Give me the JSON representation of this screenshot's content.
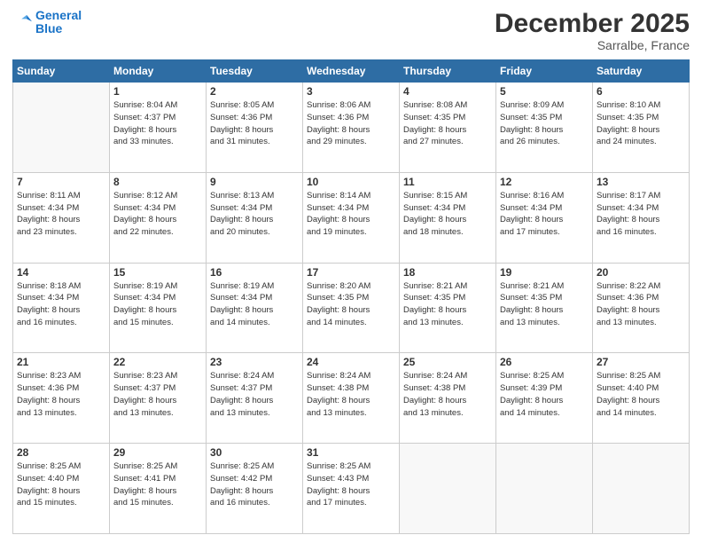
{
  "logo": {
    "line1": "General",
    "line2": "Blue"
  },
  "title": "December 2025",
  "location": "Sarralbe, France",
  "weekdays": [
    "Sunday",
    "Monday",
    "Tuesday",
    "Wednesday",
    "Thursday",
    "Friday",
    "Saturday"
  ],
  "weeks": [
    [
      {
        "day": "",
        "info": ""
      },
      {
        "day": "1",
        "info": "Sunrise: 8:04 AM\nSunset: 4:37 PM\nDaylight: 8 hours\nand 33 minutes."
      },
      {
        "day": "2",
        "info": "Sunrise: 8:05 AM\nSunset: 4:36 PM\nDaylight: 8 hours\nand 31 minutes."
      },
      {
        "day": "3",
        "info": "Sunrise: 8:06 AM\nSunset: 4:36 PM\nDaylight: 8 hours\nand 29 minutes."
      },
      {
        "day": "4",
        "info": "Sunrise: 8:08 AM\nSunset: 4:35 PM\nDaylight: 8 hours\nand 27 minutes."
      },
      {
        "day": "5",
        "info": "Sunrise: 8:09 AM\nSunset: 4:35 PM\nDaylight: 8 hours\nand 26 minutes."
      },
      {
        "day": "6",
        "info": "Sunrise: 8:10 AM\nSunset: 4:35 PM\nDaylight: 8 hours\nand 24 minutes."
      }
    ],
    [
      {
        "day": "7",
        "info": "Sunrise: 8:11 AM\nSunset: 4:34 PM\nDaylight: 8 hours\nand 23 minutes."
      },
      {
        "day": "8",
        "info": "Sunrise: 8:12 AM\nSunset: 4:34 PM\nDaylight: 8 hours\nand 22 minutes."
      },
      {
        "day": "9",
        "info": "Sunrise: 8:13 AM\nSunset: 4:34 PM\nDaylight: 8 hours\nand 20 minutes."
      },
      {
        "day": "10",
        "info": "Sunrise: 8:14 AM\nSunset: 4:34 PM\nDaylight: 8 hours\nand 19 minutes."
      },
      {
        "day": "11",
        "info": "Sunrise: 8:15 AM\nSunset: 4:34 PM\nDaylight: 8 hours\nand 18 minutes."
      },
      {
        "day": "12",
        "info": "Sunrise: 8:16 AM\nSunset: 4:34 PM\nDaylight: 8 hours\nand 17 minutes."
      },
      {
        "day": "13",
        "info": "Sunrise: 8:17 AM\nSunset: 4:34 PM\nDaylight: 8 hours\nand 16 minutes."
      }
    ],
    [
      {
        "day": "14",
        "info": "Sunrise: 8:18 AM\nSunset: 4:34 PM\nDaylight: 8 hours\nand 16 minutes."
      },
      {
        "day": "15",
        "info": "Sunrise: 8:19 AM\nSunset: 4:34 PM\nDaylight: 8 hours\nand 15 minutes."
      },
      {
        "day": "16",
        "info": "Sunrise: 8:19 AM\nSunset: 4:34 PM\nDaylight: 8 hours\nand 14 minutes."
      },
      {
        "day": "17",
        "info": "Sunrise: 8:20 AM\nSunset: 4:35 PM\nDaylight: 8 hours\nand 14 minutes."
      },
      {
        "day": "18",
        "info": "Sunrise: 8:21 AM\nSunset: 4:35 PM\nDaylight: 8 hours\nand 13 minutes."
      },
      {
        "day": "19",
        "info": "Sunrise: 8:21 AM\nSunset: 4:35 PM\nDaylight: 8 hours\nand 13 minutes."
      },
      {
        "day": "20",
        "info": "Sunrise: 8:22 AM\nSunset: 4:36 PM\nDaylight: 8 hours\nand 13 minutes."
      }
    ],
    [
      {
        "day": "21",
        "info": "Sunrise: 8:23 AM\nSunset: 4:36 PM\nDaylight: 8 hours\nand 13 minutes."
      },
      {
        "day": "22",
        "info": "Sunrise: 8:23 AM\nSunset: 4:37 PM\nDaylight: 8 hours\nand 13 minutes."
      },
      {
        "day": "23",
        "info": "Sunrise: 8:24 AM\nSunset: 4:37 PM\nDaylight: 8 hours\nand 13 minutes."
      },
      {
        "day": "24",
        "info": "Sunrise: 8:24 AM\nSunset: 4:38 PM\nDaylight: 8 hours\nand 13 minutes."
      },
      {
        "day": "25",
        "info": "Sunrise: 8:24 AM\nSunset: 4:38 PM\nDaylight: 8 hours\nand 13 minutes."
      },
      {
        "day": "26",
        "info": "Sunrise: 8:25 AM\nSunset: 4:39 PM\nDaylight: 8 hours\nand 14 minutes."
      },
      {
        "day": "27",
        "info": "Sunrise: 8:25 AM\nSunset: 4:40 PM\nDaylight: 8 hours\nand 14 minutes."
      }
    ],
    [
      {
        "day": "28",
        "info": "Sunrise: 8:25 AM\nSunset: 4:40 PM\nDaylight: 8 hours\nand 15 minutes."
      },
      {
        "day": "29",
        "info": "Sunrise: 8:25 AM\nSunset: 4:41 PM\nDaylight: 8 hours\nand 15 minutes."
      },
      {
        "day": "30",
        "info": "Sunrise: 8:25 AM\nSunset: 4:42 PM\nDaylight: 8 hours\nand 16 minutes."
      },
      {
        "day": "31",
        "info": "Sunrise: 8:25 AM\nSunset: 4:43 PM\nDaylight: 8 hours\nand 17 minutes."
      },
      {
        "day": "",
        "info": ""
      },
      {
        "day": "",
        "info": ""
      },
      {
        "day": "",
        "info": ""
      }
    ]
  ]
}
